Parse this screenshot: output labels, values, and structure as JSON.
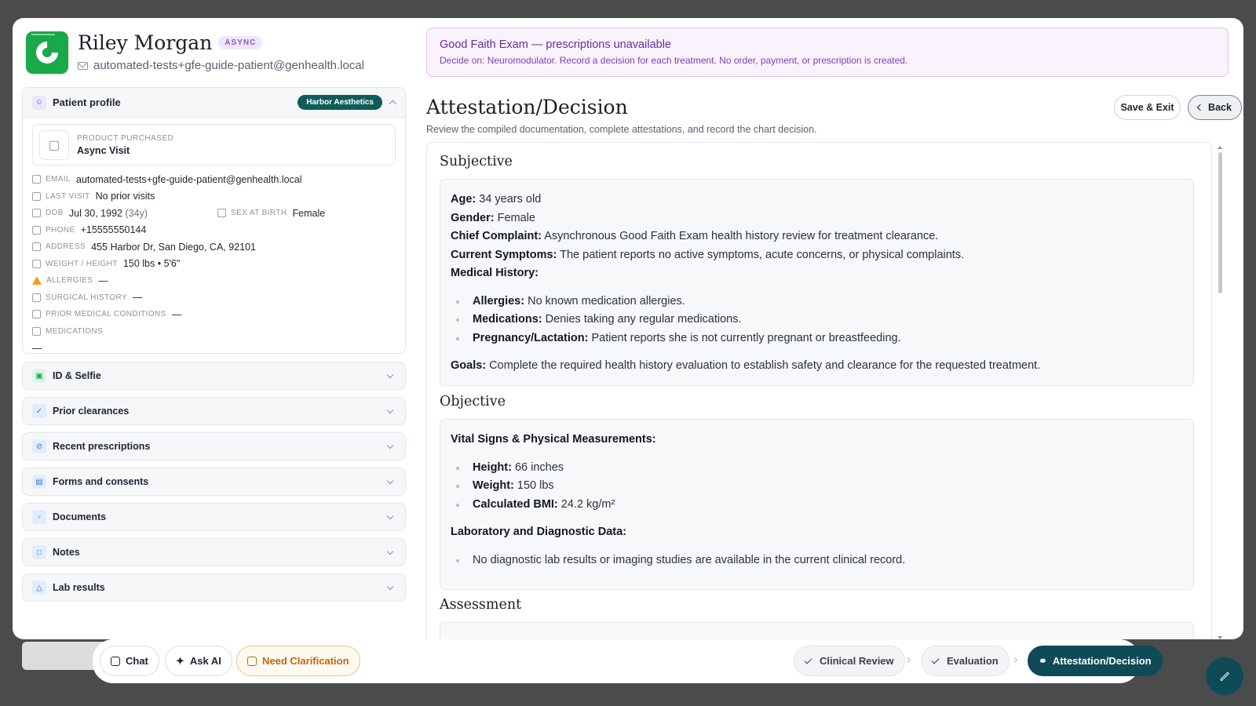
{
  "patient": {
    "name": "Riley Morgan",
    "badge": "ASYNC",
    "email": "automated-tests+gfe-guide-patient@genhealth.local"
  },
  "profile": {
    "title": "Patient profile",
    "clinic": "Harbor Aesthetics",
    "product_label": "PRODUCT PURCHASED",
    "product_value": "Async Visit",
    "fields": {
      "email": {
        "label": "EMAIL",
        "value": "automated-tests+gfe-guide-patient@genhealth.local"
      },
      "last_visit": {
        "label": "LAST VISIT",
        "value": "No prior visits"
      },
      "dob": {
        "label": "DOB",
        "value": "Jul 30, 1992",
        "age": "(34y)"
      },
      "sex": {
        "label": "SEX AT BIRTH",
        "value": "Female"
      },
      "phone": {
        "label": "PHONE",
        "value": "+15555550144"
      },
      "address": {
        "label": "ADDRESS",
        "value": "455 Harbor Dr, San Diego, CA, 92101"
      },
      "weight_height": {
        "label": "WEIGHT / HEIGHT",
        "value": "150 lbs • 5'6\""
      },
      "allergies": {
        "label": "ALLERGIES",
        "value": "—"
      },
      "surgical": {
        "label": "SURGICAL HISTORY",
        "value": "—"
      },
      "prior_conditions": {
        "label": "PRIOR MEDICAL CONDITIONS",
        "value": "—"
      },
      "medications": {
        "label": "MEDICATIONS",
        "value": "—"
      }
    }
  },
  "sections": [
    {
      "label": "ID & Selfie"
    },
    {
      "label": "Prior clearances"
    },
    {
      "label": "Recent prescriptions"
    },
    {
      "label": "Forms and consents"
    },
    {
      "label": "Documents"
    },
    {
      "label": "Notes"
    },
    {
      "label": "Lab results"
    }
  ],
  "banner": {
    "title": "Good Faith Exam — prescriptions unavailable",
    "subtitle": "Decide on: Neuromodulator. Record a decision for each treatment. No order, payment, or prescription is created."
  },
  "page": {
    "title": "Attestation/Decision",
    "subtitle": "Review the compiled documentation, complete attestations, and record the chart decision.",
    "save_exit": "Save & Exit",
    "back": "Back"
  },
  "subjective": {
    "title": "Subjective",
    "age_k": "Age:",
    "age_v": " 34 years old",
    "gender_k": "Gender:",
    "gender_v": " Female",
    "cc_k": "Chief Complaint:",
    "cc_v": " Asynchronous Good Faith Exam health history review for treatment clearance.",
    "sym_k": "Current Symptoms:",
    "sym_v": " The patient reports no active symptoms, acute concerns, or physical complaints.",
    "mh_k": "Medical History:",
    "items": [
      {
        "k": "Allergies:",
        "v": " No known medication allergies."
      },
      {
        "k": "Medications:",
        "v": " Denies taking any regular medications."
      },
      {
        "k": "Pregnancy/Lactation:",
        "v": " Patient reports she is not currently pregnant or breastfeeding."
      }
    ],
    "goals_k": "Goals:",
    "goals_v": " Complete the required health history evaluation to establish safety and clearance for the requested treatment."
  },
  "objective": {
    "title": "Objective",
    "vitals_k": "Vital Signs & Physical Measurements:",
    "items": [
      {
        "k": "Height:",
        "v": " 66 inches"
      },
      {
        "k": "Weight:",
        "v": " 150 lbs"
      },
      {
        "k": "Calculated BMI:",
        "v": " 24.2 kg/m²"
      }
    ],
    "lab_k": "Laboratory and Diagnostic Data:",
    "lab_item": "No diagnostic lab results or imaging studies are available in the current clinical record."
  },
  "assessment": {
    "title": "Assessment"
  },
  "bottom": {
    "chat": "Chat",
    "ask_ai": "Ask AI",
    "clarify": "Need Clarification",
    "step1": "Clinical Review",
    "step2": "Evaluation",
    "step3": "Attestation/Decision"
  },
  "colors": {
    "accent": "#0f4a57",
    "clinic_badge": "#0f5c5a",
    "banner_bg": "#faf3fd",
    "warn": "#c1660e"
  }
}
